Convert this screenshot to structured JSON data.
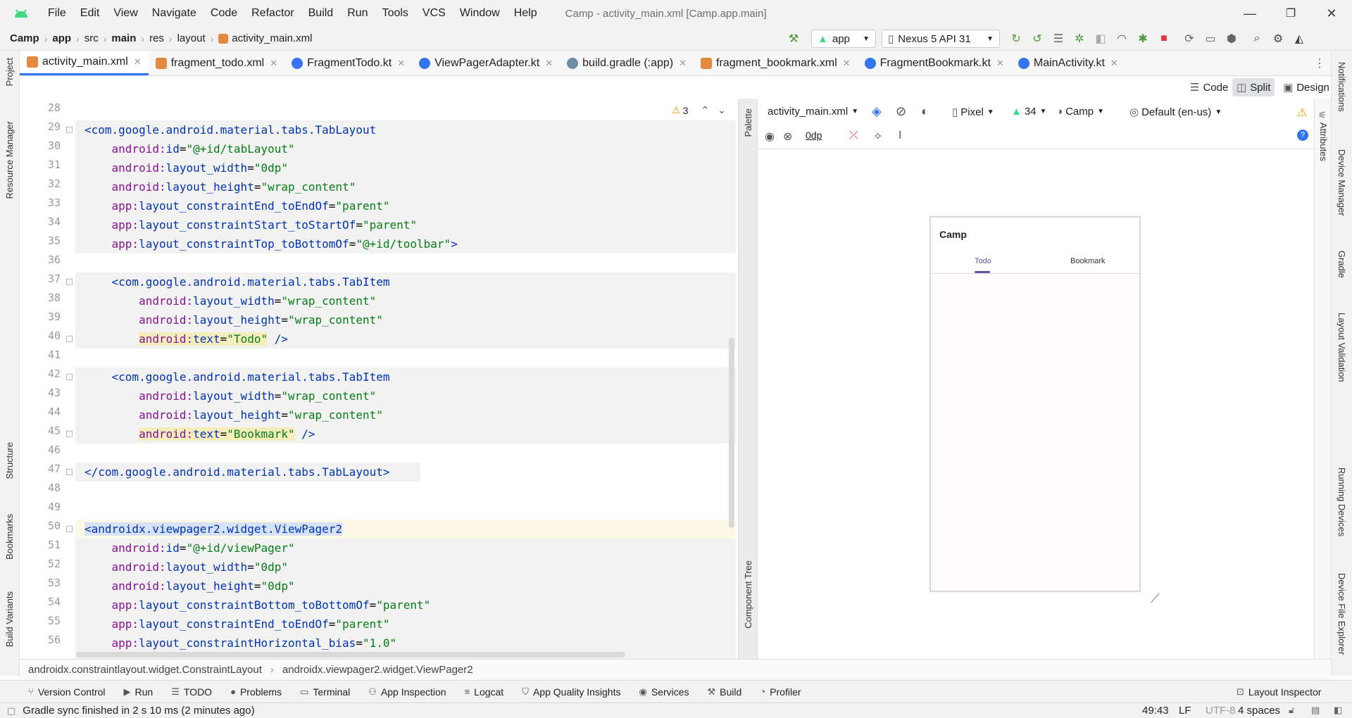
{
  "titlebar": {
    "menu": [
      "File",
      "Edit",
      "View",
      "Navigate",
      "Code",
      "Refactor",
      "Build",
      "Run",
      "Tools",
      "VCS",
      "Window",
      "Help"
    ],
    "window_title": "Camp - activity_main.xml [Camp.app.main]",
    "minimize": "—",
    "restore": "❐",
    "close": "✕"
  },
  "navbar": {
    "crumbs": [
      "Camp",
      "app",
      "src",
      "main",
      "res",
      "layout",
      "activity_main.xml"
    ],
    "run_config": "app",
    "device": "Nexus 5 API 31"
  },
  "tabs": [
    {
      "label": "activity_main.xml",
      "color": "#e2893d"
    },
    {
      "label": "fragment_todo.xml",
      "color": "#e2893d"
    },
    {
      "label": "FragmentTodo.kt",
      "color": "#3574f0"
    },
    {
      "label": "ViewPagerAdapter.kt",
      "color": "#3574f0"
    },
    {
      "label": "build.gradle (:app)",
      "color": "#6d8fa6"
    },
    {
      "label": "fragment_bookmark.xml",
      "color": "#e2893d"
    },
    {
      "label": "FragmentBookmark.kt",
      "color": "#3574f0"
    },
    {
      "label": "MainActivity.kt",
      "color": "#3574f0"
    }
  ],
  "tab_close": "✕",
  "modes": {
    "code": "Code",
    "split": "Split",
    "design": "Design"
  },
  "left_strip": {
    "project": "Project",
    "resource_manager": "Resource Manager",
    "structure": "Structure",
    "bookmarks": "Bookmarks",
    "build_variants": "Build Variants"
  },
  "right_strip": {
    "notifications": "Notifications",
    "device_manager": "Device Manager",
    "gradle": "Gradle",
    "layout_validation": "Layout Validation",
    "running_devices": "Running Devices",
    "device_file_explorer": "Device File Explorer"
  },
  "editor": {
    "warning_count": "3",
    "line_numbers": [
      "28",
      "29",
      "30",
      "31",
      "32",
      "33",
      "34",
      "35",
      "36",
      "37",
      "38",
      "39",
      "40",
      "41",
      "42",
      "43",
      "44",
      "45",
      "46",
      "47",
      "48",
      "49",
      "50",
      "51",
      "52",
      "53",
      "54",
      "55",
      "56"
    ]
  },
  "palette_label": "Palette",
  "component_tree_label": "Component Tree",
  "attributes_label": "Attributes",
  "designer": {
    "file": "activity_main.xml",
    "device": "Pixel",
    "api": "34",
    "theme": "Camp",
    "locale": "Default (en-us)",
    "margin": "0dp",
    "app_title": "Camp",
    "tab_todo": "Todo",
    "tab_bookmark": "Bookmark",
    "accent": "#6750a4"
  },
  "breadcrumbs": [
    "androidx.constraintlayout.widget.ConstraintLayout",
    "androidx.viewpager2.widget.ViewPager2"
  ],
  "bottom_tools": [
    "Version Control",
    "Run",
    "TODO",
    "Problems",
    "Terminal",
    "App Inspection",
    "Logcat",
    "App Quality Insights",
    "Services",
    "Build",
    "Profiler"
  ],
  "layout_inspector": "Layout Inspector",
  "status": {
    "message": "Gradle sync finished in 2 s 10 ms (2 minutes ago)",
    "position": "49:43",
    "line_sep": "LF",
    "encoding": "UTF-8",
    "indent": "4 spaces"
  }
}
